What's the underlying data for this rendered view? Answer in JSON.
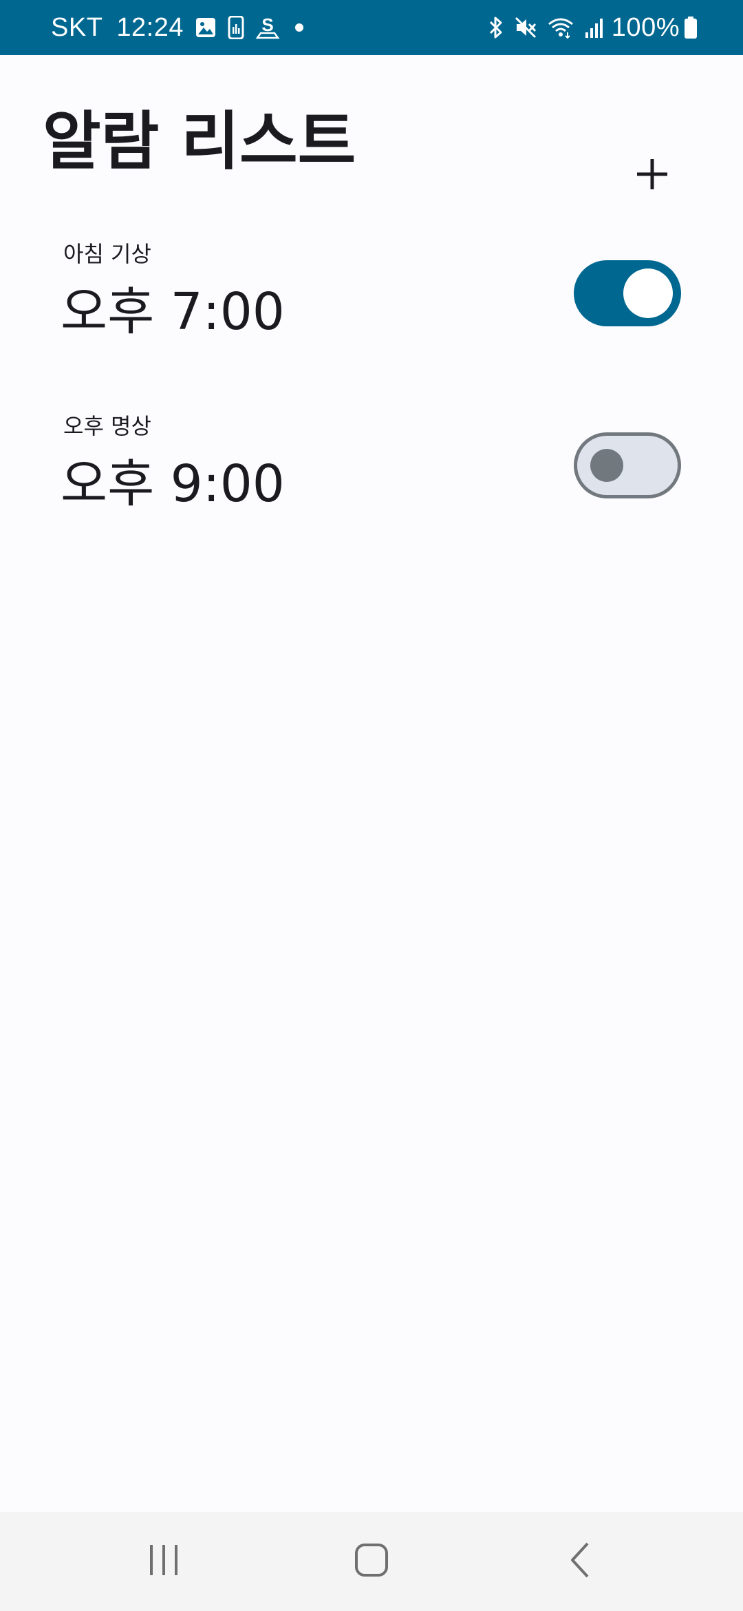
{
  "status_bar": {
    "carrier": "SKT",
    "time": "12:24",
    "battery": "100%",
    "left_icons": [
      "image-icon",
      "phone-stats-icon",
      "s-app-icon",
      "dot-icon"
    ],
    "right_icons": [
      "bluetooth-icon",
      "mute-icon",
      "wifi-icon",
      "signal-icon",
      "battery-icon"
    ],
    "background": "#006790"
  },
  "header": {
    "title": "알람 리스트",
    "add_icon": "plus-icon"
  },
  "alarms": [
    {
      "label": "아침 기상",
      "time": "오후 7:00",
      "enabled": true
    },
    {
      "label": "오후 명상",
      "time": "오후 9:00",
      "enabled": false
    }
  ],
  "nav_bar": {
    "buttons": [
      "recent-apps-icon",
      "home-icon",
      "back-icon"
    ]
  },
  "colors": {
    "accent": "#006790",
    "background": "#fcfcff",
    "text": "#1b1b1f",
    "toggle_off_track": "#dfe3eb",
    "toggle_off_outline": "#71787e"
  }
}
